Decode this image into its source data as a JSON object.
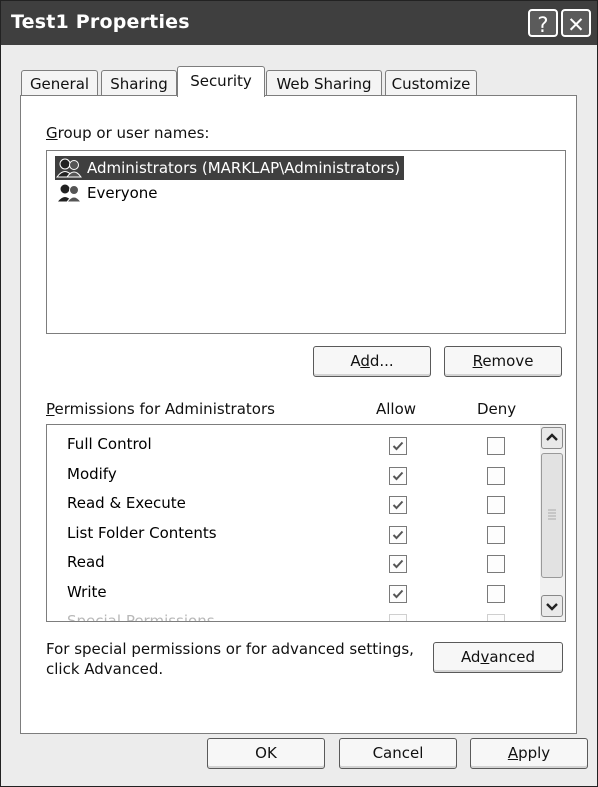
{
  "window": {
    "title": "Test1 Properties",
    "help_label": "?",
    "close_label": "✕"
  },
  "tabs": [
    {
      "label": "General"
    },
    {
      "label": "Sharing"
    },
    {
      "label": "Security"
    },
    {
      "label": "Web Sharing"
    },
    {
      "label": "Customize"
    }
  ],
  "groups": {
    "label_first": "G",
    "label_rest": "roup or user names:",
    "items": [
      {
        "name": "Administrators (MARKLAP\\Administrators)",
        "selected": true
      },
      {
        "name": "Everyone",
        "selected": false
      }
    ]
  },
  "buttons": {
    "add_pre": "A",
    "add_u": "d",
    "add_post": "d...",
    "remove_u": "R",
    "remove_post": "emove",
    "advanced_pre": "Ad",
    "advanced_u": "v",
    "advanced_post": "anced",
    "ok": "OK",
    "cancel": "Cancel",
    "apply_u": "A",
    "apply_post": "pply"
  },
  "permissions": {
    "label_u": "P",
    "label_rest": "ermissions for Administrators",
    "allow_header": "Allow",
    "deny_header": "Deny",
    "rows": [
      {
        "name": "Full Control",
        "allow": true,
        "deny": false
      },
      {
        "name": "Modify",
        "allow": true,
        "deny": false
      },
      {
        "name": "Read & Execute",
        "allow": true,
        "deny": false
      },
      {
        "name": "List Folder Contents",
        "allow": true,
        "deny": false
      },
      {
        "name": "Read",
        "allow": true,
        "deny": false
      },
      {
        "name": "Write",
        "allow": true,
        "deny": false
      },
      {
        "name": "Special Permissions",
        "allow": false,
        "deny": false
      }
    ]
  },
  "advanced_note": {
    "line1": "For special permissions or for advanced settings,",
    "line2": "click Advanced."
  },
  "icons": [
    "user-group-icon",
    "help-icon",
    "close-icon",
    "scroll-up-icon",
    "scroll-down-icon",
    "checkmark-icon"
  ]
}
